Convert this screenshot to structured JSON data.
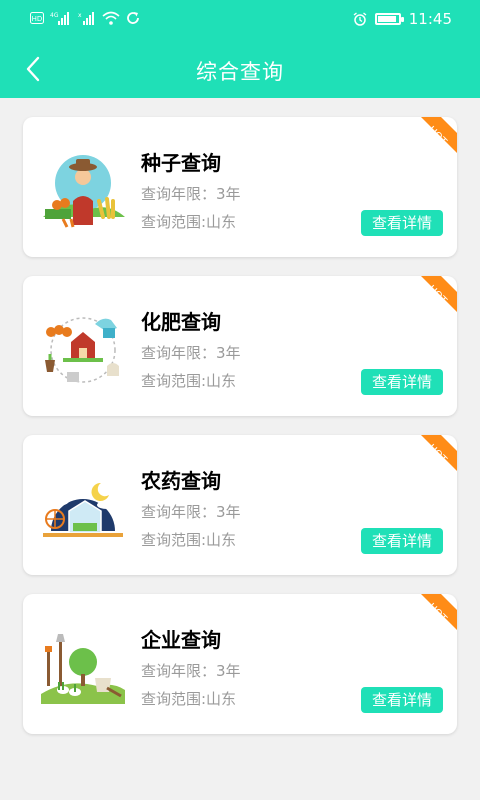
{
  "status_bar": {
    "time": "11:45",
    "icons": [
      "hd-icon",
      "signal-4g-icon",
      "signal-icon",
      "wifi-icon",
      "sync-icon",
      "alarm-icon",
      "battery-icon"
    ]
  },
  "nav": {
    "title": "综合查询",
    "back_icon": "chevron-left-icon"
  },
  "colors": {
    "accent": "#1fe0b7",
    "hot_ribbon": "#ff8c17",
    "muted_text": "#9a9a9a"
  },
  "cards": [
    {
      "title": "种子查询",
      "years": "查询年限：3年",
      "scope": "查询范围:山东",
      "button": "查看详情",
      "badge": "HOT",
      "illustration": "farmer-illustration"
    },
    {
      "title": "化肥查询",
      "years": "查询年限：3年",
      "scope": "查询范围:山东",
      "button": "查看详情",
      "badge": "HOT",
      "illustration": "farm-cycle-illustration"
    },
    {
      "title": "农药查询",
      "years": "查询年限：3年",
      "scope": "查询范围:山东",
      "button": "查看详情",
      "badge": "HOT",
      "illustration": "greenhouse-illustration"
    },
    {
      "title": "企业查询",
      "years": "查询年限：3年",
      "scope": "查询范围:山东",
      "button": "查看详情",
      "badge": "HOT",
      "illustration": "garden-tools-illustration"
    }
  ]
}
